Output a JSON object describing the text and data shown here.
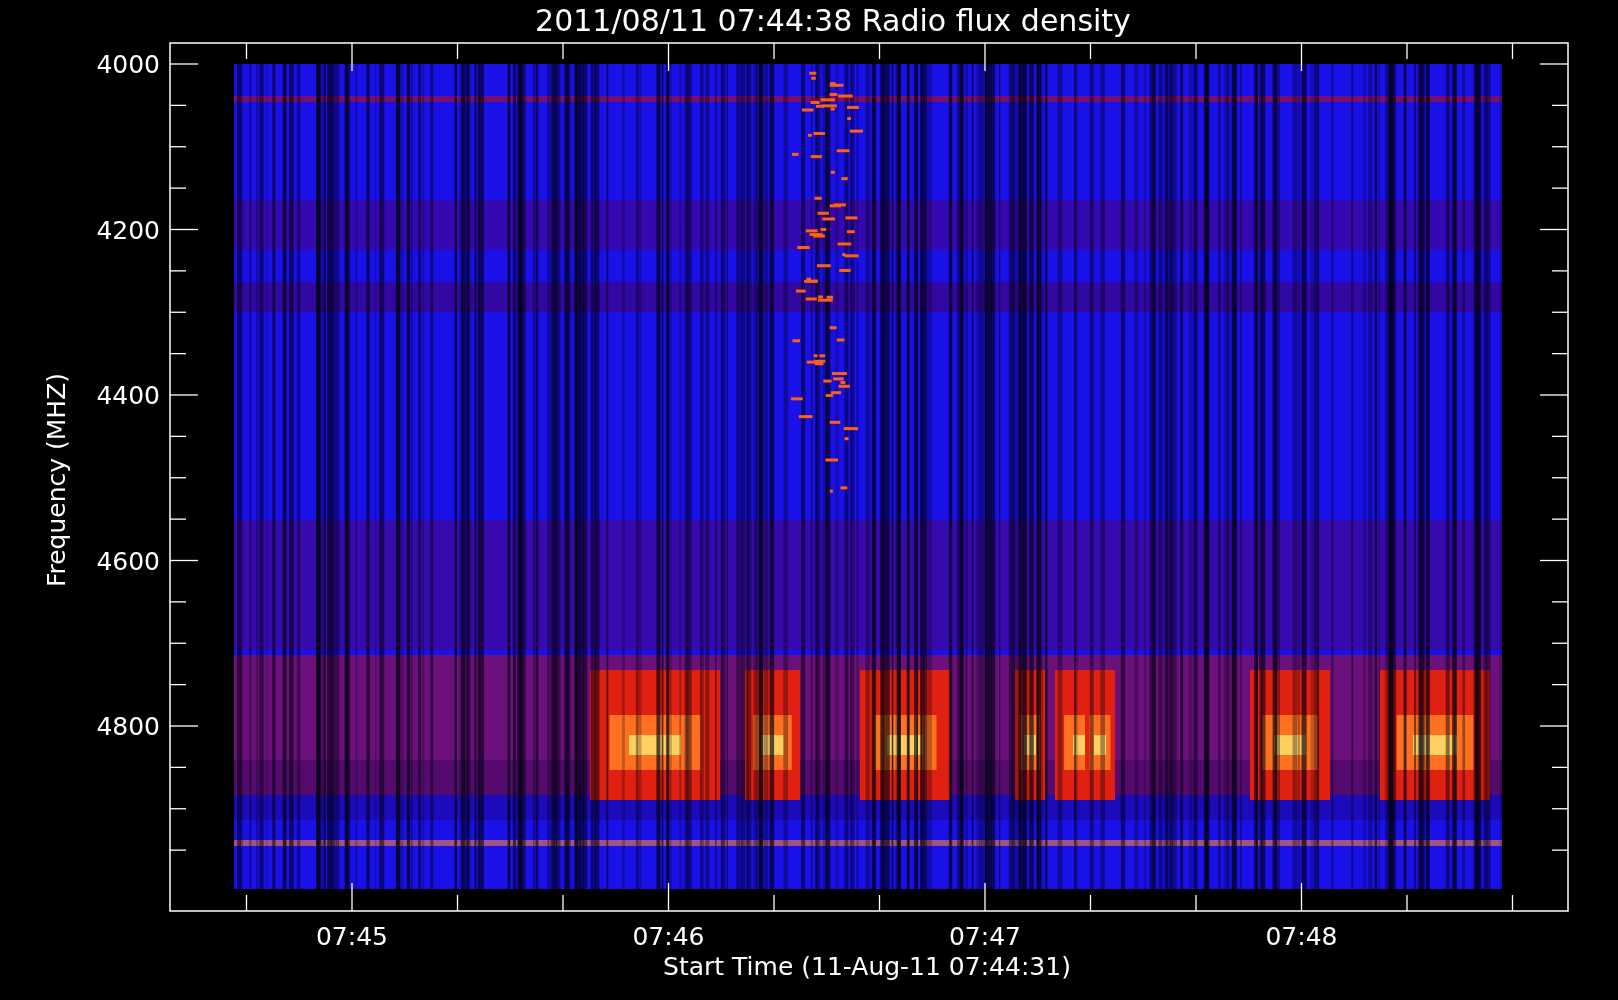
{
  "title": "2011/08/11 07:44:38 Radio flux density",
  "y_axis": {
    "label": "Frequency (MHZ)",
    "ticks": [
      "4000",
      "4200",
      "4400",
      "4600",
      "4800"
    ]
  },
  "x_axis": {
    "label": "Start Time (11-Aug-11 07:44:31)",
    "ticks": [
      "07:45",
      "07:46",
      "07:47",
      "07:48"
    ]
  }
}
